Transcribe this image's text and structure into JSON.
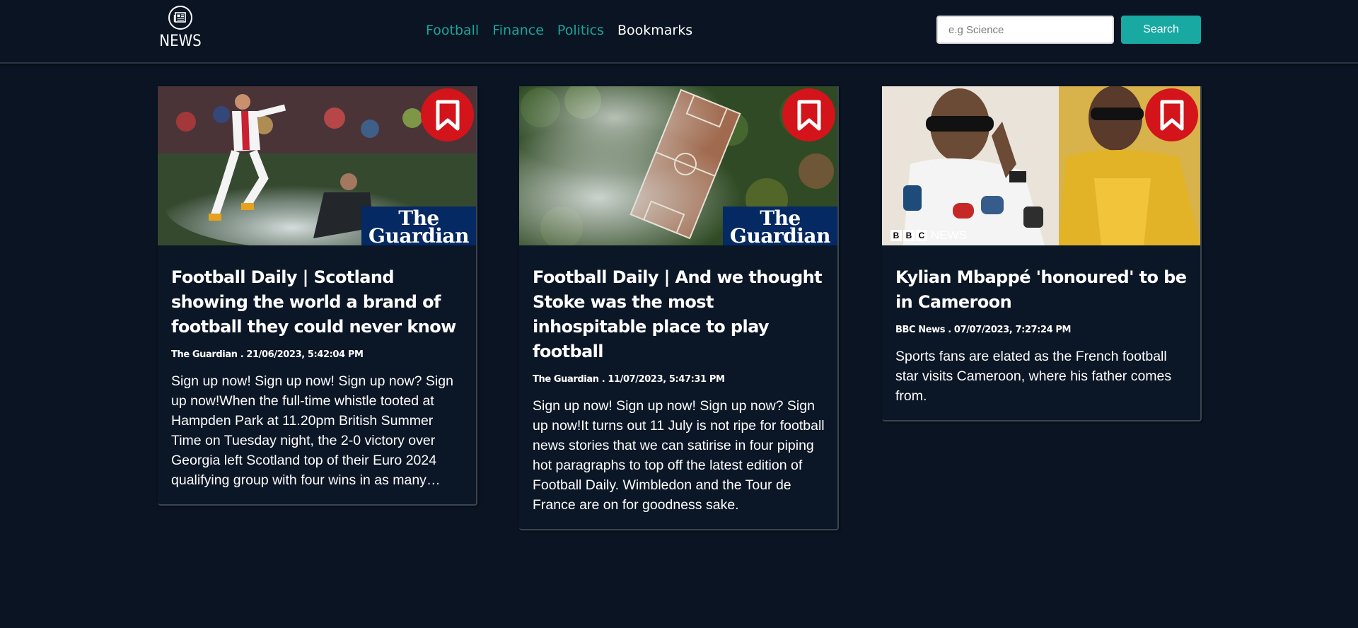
{
  "header": {
    "logo_text": "NEWS",
    "nav": [
      {
        "label": "Football"
      },
      {
        "label": "Finance"
      },
      {
        "label": "Politics"
      },
      {
        "label": "Bookmarks"
      }
    ],
    "search": {
      "placeholder": "e.g Science",
      "value": "",
      "button_label": "Search"
    }
  },
  "colors": {
    "background": "#0a1422",
    "accent": "#18a9a3",
    "bookmark": "#d3141b",
    "guardian_blue": "#052962"
  },
  "articles": [
    {
      "source_badge": [
        "The",
        "Guardian"
      ],
      "title": "Football Daily | Scotland showing the world a brand of football they could never know",
      "meta": "The Guardian . 21/06/2023, 5:42:04 PM",
      "description": "Sign up now! Sign up now! Sign up now? Sign up now!When the full-time whistle tooted at Hampden Park at 11.20pm British Summer Time on Tuesday night, the 2-0 victory over Georgia left Scotland top of their Euro 2024 qualifying group with four wins in as many games."
    },
    {
      "source_badge": [
        "The",
        "Guardian"
      ],
      "title": "Football Daily | And we thought Stoke was the most inhospitable place to play football",
      "meta": "The Guardian . 11/07/2023, 5:47:31 PM",
      "description": "Sign up now! Sign up now! Sign up now? Sign up now!It turns out 11 July is not ripe for football news stories that we can satirise in four piping hot paragraphs to top off the latest edition of Football Daily. Wimbledon and the Tour de France are on for goodness sake."
    },
    {
      "source_badge": [
        "B",
        "B",
        "C",
        "NEWS"
      ],
      "title": "Kylian Mbappé 'honoured' to be in Cameroon",
      "meta": "BBC News . 07/07/2023, 7:27:24 PM",
      "description": "Sports fans are elated as the French football star visits Cameroon, where his father comes from."
    }
  ]
}
